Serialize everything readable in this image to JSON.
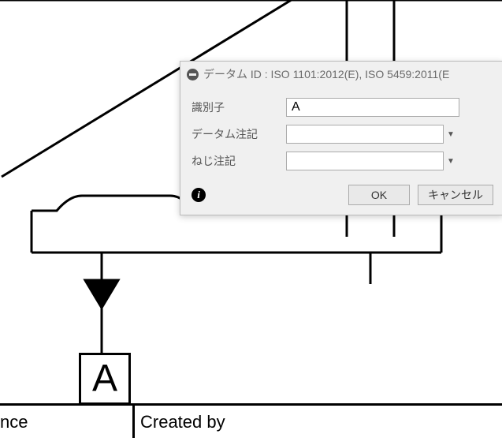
{
  "dialog": {
    "title": "データム ID : ISO 1101:2012(E), ISO 5459:2011(E",
    "fields": {
      "identifier": {
        "label": "識別子",
        "value": "A"
      },
      "datum_note": {
        "label": "データム注記",
        "value": ""
      },
      "thread_note": {
        "label": "ねじ注記",
        "value": ""
      }
    },
    "buttons": {
      "ok": "OK",
      "cancel": "キャンセル"
    },
    "info_glyph": "i"
  },
  "drawing": {
    "datum_letter": "A"
  },
  "title_block": {
    "left_fragment": "nce",
    "created_by": "Created by"
  }
}
